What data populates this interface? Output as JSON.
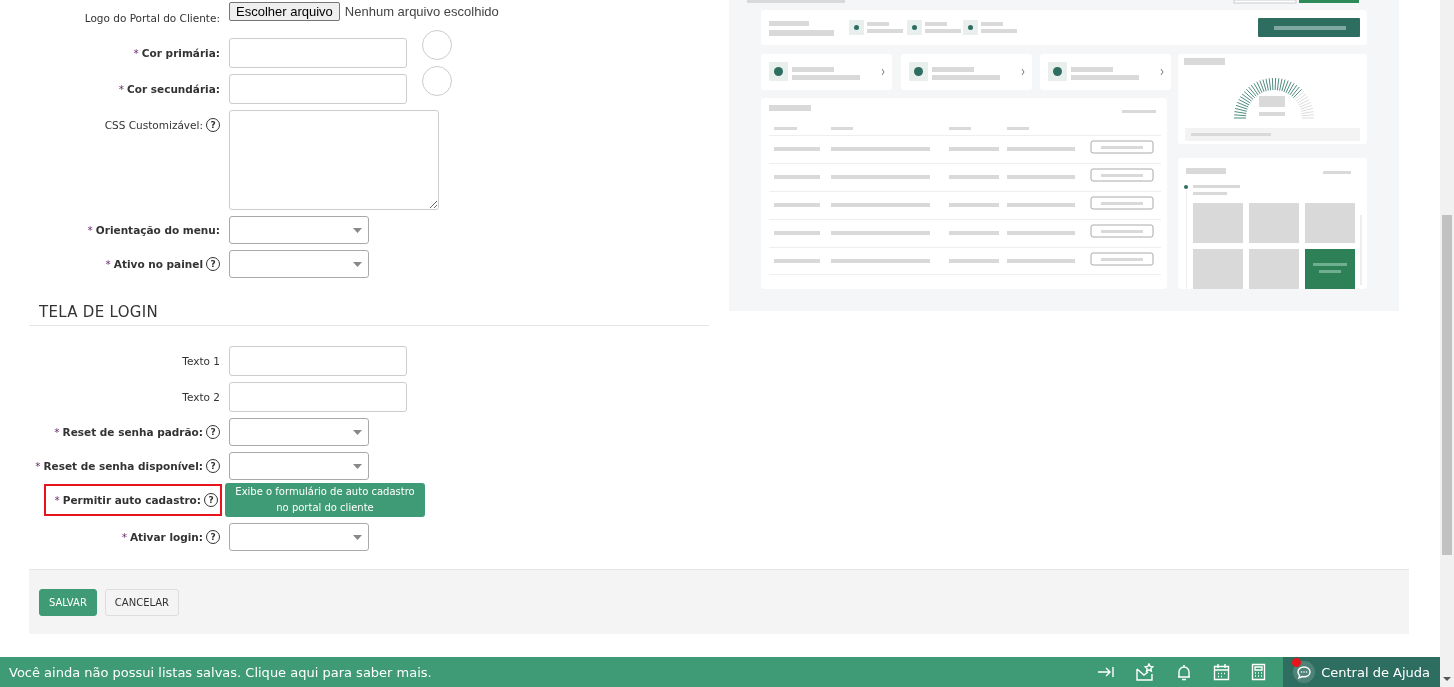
{
  "form": {
    "fields": [
      {
        "kind": "file",
        "label": "Logo do Portal do Cliente:",
        "required": false,
        "button": "Escolher arquivo",
        "value": "Nenhum arquivo escolhido"
      },
      {
        "kind": "color",
        "label": "Cor primária:",
        "required": true,
        "asterisk": "*"
      },
      {
        "kind": "color",
        "label": "Cor secundária:",
        "required": true,
        "asterisk": "*"
      },
      {
        "kind": "textarea",
        "label": "CSS Customizável:",
        "required": false,
        "help": "?"
      },
      {
        "kind": "select",
        "label": "Orientação do menu:",
        "required": true,
        "asterisk": "*"
      },
      {
        "kind": "select",
        "label": "Ativo no painel",
        "required": true,
        "asterisk": "*",
        "help": "?"
      }
    ],
    "section": {
      "title": "TELA DE LOGIN",
      "fields": [
        {
          "kind": "text",
          "label": "Texto 1",
          "required": false
        },
        {
          "kind": "text",
          "label": "Texto 2",
          "required": false
        },
        {
          "kind": "select",
          "label": "Reset de senha padrão:",
          "required": true,
          "asterisk": "*",
          "help": "?"
        },
        {
          "kind": "select",
          "label": "Reset de senha disponível:",
          "required": true,
          "asterisk": "*",
          "help": "?"
        },
        {
          "kind": "tooltip",
          "label": "Permitir auto cadastro:",
          "required": true,
          "asterisk": "*",
          "help": "?",
          "highlighted": true,
          "tooltip": "Exibe o formulário de auto cadastro no portal do cliente"
        },
        {
          "kind": "select",
          "label": "Ativar login:",
          "required": true,
          "asterisk": "*",
          "help": "?"
        }
      ]
    },
    "buttons": [
      {
        "label": "SALVAR",
        "kind": "primary"
      },
      {
        "label": "CANCELAR",
        "kind": "secondary"
      }
    ]
  },
  "status_bar": {
    "message": "Você ainda não possui listas salvas. Clique aqui para saber mais.",
    "help_center": {
      "label": "Central de Ajuda",
      "notification": true
    }
  }
}
